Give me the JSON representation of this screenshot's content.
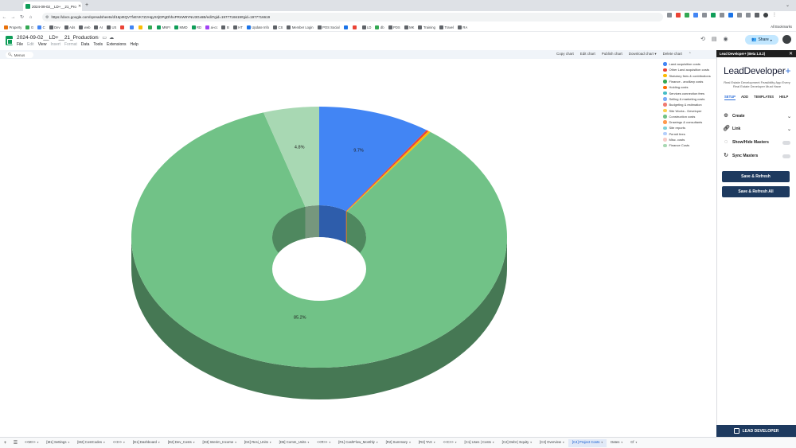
{
  "browser": {
    "tab_title": "2024-09-02__LD+__21_Pro",
    "url": "https://docs.google.com/spreadsheets/d/16pIItQV7fvEVK7ZJHqyXrIjDPgDhhxPRnW9YNU3Gx6B/edit?gid=1977716619#gid=1977716619",
    "bookmarks": [
      {
        "label": "Property",
        "color": "#e8710a"
      },
      {
        "label": "G",
        "color": "#34a853"
      },
      {
        "label": "C",
        "color": "#4285f4"
      },
      {
        "label": "Dev",
        "color": "#5f6368"
      },
      {
        "label": "Ads",
        "color": "#5f6368"
      },
      {
        "label": "web",
        "color": "#5f6368"
      },
      {
        "label": "AI",
        "color": "#5f6368"
      },
      {
        "label": "US",
        "color": "#5f6368"
      },
      {
        "label": "",
        "color": "#ea4335"
      },
      {
        "label": "",
        "color": "#4285f4"
      },
      {
        "label": "",
        "color": "#fbbc04"
      },
      {
        "label": "",
        "color": "#34a853"
      },
      {
        "label": "MNFI",
        "color": "#0f9d58"
      },
      {
        "label": "MMD",
        "color": "#0f9d58"
      },
      {
        "label": "RD",
        "color": "#0f9d58"
      },
      {
        "label": "ai-cc",
        "color": "#a142f4"
      },
      {
        "label": "B",
        "color": "#5f6368"
      },
      {
        "label": "HT",
        "color": "#5f6368"
      },
      {
        "label": "Update Info",
        "color": "#1a73e8"
      },
      {
        "label": "CS",
        "color": "#5f6368"
      },
      {
        "label": "Member Login",
        "color": "#5f6368"
      },
      {
        "label": "POS Social",
        "color": "#5f6368"
      },
      {
        "label": "",
        "color": "#1a73e8"
      },
      {
        "label": "",
        "color": "#ea4335"
      },
      {
        "label": "LD",
        "color": "#5f6368"
      },
      {
        "label": "db",
        "color": "#34a853"
      },
      {
        "label": "PDS",
        "color": "#5f6368"
      },
      {
        "label": "MK",
        "color": "#5f6368"
      },
      {
        "label": "Training",
        "color": "#5f6368"
      },
      {
        "label": "Travel",
        "color": "#5f6368"
      },
      {
        "label": "RA",
        "color": "#5f6368"
      }
    ],
    "all_bookmarks": "All Bookmarks"
  },
  "sheet": {
    "title": "2024-09-02__LD+__21_Production",
    "menu": [
      "File",
      "Edit",
      "View",
      "Insert",
      "Format",
      "Data",
      "Tools",
      "Extensions",
      "Help"
    ],
    "menu_dim": [
      false,
      true,
      false,
      true,
      true,
      false,
      false,
      false,
      false
    ],
    "share_label": "Share",
    "search_placeholder": "Menus"
  },
  "chart_toolbar": {
    "copy": "Copy chart",
    "edit": "Edit chart",
    "publish": "Publish chart",
    "download": "Download chart ▾",
    "delete": "Delete chart"
  },
  "chart_data": {
    "type": "pie",
    "style": "3d-doughnut",
    "title": "",
    "legend_position": "right",
    "slices": [
      {
        "label": "Land acquisition costs",
        "value": 9.7,
        "color": "#4285f4"
      },
      {
        "label": "Other Land acquisition costs",
        "value": 0.2,
        "color": "#ea4335"
      },
      {
        "label": "Statutory fees & contributions",
        "value": 0.2,
        "color": "#fbbc04"
      },
      {
        "label": "Finance - ancillary costs",
        "value": 0.0,
        "color": "#34a853"
      },
      {
        "label": "Holding costs",
        "value": 0.0,
        "color": "#ff6d01"
      },
      {
        "label": "Services connection fees",
        "value": 0.0,
        "color": "#46bdc6"
      },
      {
        "label": "Selling & marketing costs",
        "value": 0.0,
        "color": "#7baaf7"
      },
      {
        "label": "Budgeting & estimation",
        "value": 0.0,
        "color": "#f07b72"
      },
      {
        "label": "Site Works - Developer",
        "value": 0.0,
        "color": "#fcd04f"
      },
      {
        "label": "Construction costs",
        "value": 85.2,
        "color": "#71c287"
      },
      {
        "label": "Drawings & consultants",
        "value": 0.0,
        "color": "#ff994d"
      },
      {
        "label": "Site reports",
        "value": 0.0,
        "color": "#7ed1d7"
      },
      {
        "label": "Permit fees",
        "value": 0.0,
        "color": "#b3cefb"
      },
      {
        "label": "Misc. costs",
        "value": 0.0,
        "color": "#f7cbc7"
      },
      {
        "label": "Finance Costs",
        "value": 4.8,
        "color": "#a8d8b3"
      }
    ],
    "data_labels": [
      "9.7%",
      "85.2%",
      "4.8%"
    ]
  },
  "sidebar": {
    "header": "Lead Developer+ (Beta 1.0.2)",
    "brand": "LeadDeveloper",
    "brand_plus": "+",
    "tagline": "Real Estate Development Feasibility App Every Real Estate Developer Must Have",
    "tabs": [
      "SETUP",
      "ADD",
      "TEMPLATES",
      "HELP"
    ],
    "rows": {
      "create": "Create",
      "link": "Link",
      "show_hide": "Show/Hide Masters",
      "sync": "Sync Masters"
    },
    "save_refresh": "Save & Refresh",
    "save_refresh_all": "Save & Refresh All",
    "footer": "LEAD DEVELOPER"
  },
  "sheet_tabs": [
    "<<M>>",
    "[M1] Settings",
    "[M2] CostCodes",
    "<<I>>",
    "[D1] Dashboard",
    "[D2] Dev_Costs",
    "[D3] Interim_Income",
    "[D4] Resi_Units",
    "[D5] Comm_Units",
    "<<R>>",
    "[R1] CashFlow_Monthly",
    "[R2] Summary",
    "[R3] TAX",
    "<<C>>",
    "[C1] Uses | Costs",
    "[C2] Debt | Equity",
    "[C3] Overview",
    "[C4] Project Costs",
    "Dates",
    "Cf"
  ],
  "active_sheet_tab": 17
}
